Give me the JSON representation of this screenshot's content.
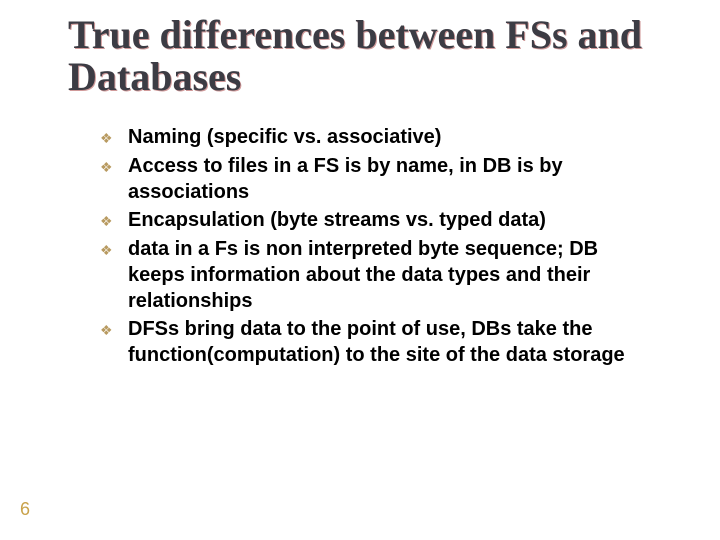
{
  "title": "True differences between FSs and Databases",
  "bullets": [
    "Naming (specific vs. associative)",
    "Access to files in a FS is by name, in DB is by associations",
    "Encapsulation (byte streams vs. typed data)",
    "data in a Fs is non interpreted byte sequence; DB keeps information about the data types and their relationships",
    "DFSs bring data to the point of use, DBs take the function(computation) to the site of the data storage"
  ],
  "page_number": "6",
  "bullet_glyph": "❖"
}
